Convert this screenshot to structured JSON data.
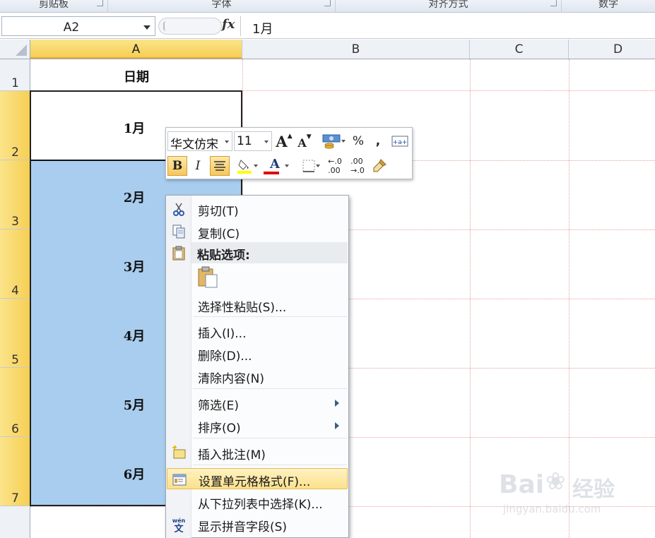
{
  "ribbon": {
    "groups": [
      "剪贴板",
      "字体",
      "对齐方式",
      "数字"
    ]
  },
  "formula_bar": {
    "name_box": "A2",
    "fx_label": "fx",
    "content": "1月"
  },
  "columns": [
    "A",
    "B",
    "C",
    "D"
  ],
  "rows": [
    "1",
    "2",
    "3",
    "4",
    "5",
    "6",
    "7"
  ],
  "cells": {
    "A1": "日期",
    "A2": "1月",
    "A3": "2月",
    "A4": "3月",
    "A5": "4月",
    "A6": "5月",
    "A7": "6月"
  },
  "mini_toolbar": {
    "font_name": "华文仿宋",
    "font_size": "11",
    "grow_font": "A",
    "shrink_font": "A",
    "percent": "%",
    "comma": ",",
    "bold": "B",
    "italic": "I",
    "font_color_glyph": "A",
    "highlight_color": "#ffff00",
    "font_color": "#e00000"
  },
  "context_menu": {
    "cut": "剪切(T)",
    "copy": "复制(C)",
    "paste_options": "粘贴选项:",
    "paste_special": "选择性粘贴(S)...",
    "insert": "插入(I)...",
    "delete": "删除(D)...",
    "clear_contents": "清除内容(N)",
    "filter": "筛选(E)",
    "sort": "排序(O)",
    "insert_comment": "插入批注(M)",
    "format_cells": "设置单元格格式(F)...",
    "pick_from_list": "从下拉列表中选择(K)...",
    "phonetic": "显示拼音字段(S)"
  },
  "watermark": {
    "brand": "Bai",
    "brand_cn": "经验",
    "url": "jingyan.baidu.com"
  }
}
